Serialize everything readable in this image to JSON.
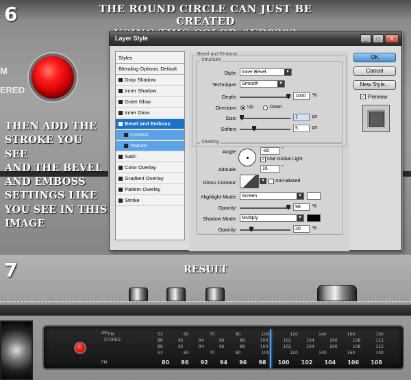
{
  "step6": {
    "number": "6",
    "title_line1": "THE ROUND CIRCLE CAN JUST BE CREATED",
    "title_line2": "USING THIS COLOR #EB0202",
    "instructions": [
      "THEN ADD THE",
      "STROKE YOU SEE",
      "AND THE BEVEL",
      "AND EMBOSS",
      "SETTINGS LIKE",
      "YOU SEE IN THIS",
      "IMAGE"
    ],
    "stereo_label_top": "M",
    "stereo_label_bottom": "ERED",
    "circle_color": "#EB0202"
  },
  "dialog": {
    "title": "Layer Style",
    "window_controls": {
      "minimize": "_",
      "maximize": "□",
      "close": "X"
    },
    "styles_list": [
      {
        "label": "Styles",
        "kind": "header"
      },
      {
        "label": "Blending Options: Default",
        "kind": "header"
      },
      {
        "label": "Drop Shadow",
        "kind": "item"
      },
      {
        "label": "Inner Shadow",
        "kind": "item"
      },
      {
        "label": "Outer Glow",
        "kind": "item"
      },
      {
        "label": "Inner Glow",
        "kind": "item"
      },
      {
        "label": "Bevel and Emboss",
        "kind": "selected"
      },
      {
        "label": "Contour",
        "kind": "sub"
      },
      {
        "label": "Texture",
        "kind": "sub"
      },
      {
        "label": "Satin",
        "kind": "item"
      },
      {
        "label": "Color Overlay",
        "kind": "item"
      },
      {
        "label": "Gradient Overlay",
        "kind": "item"
      },
      {
        "label": "Pattern Overlay",
        "kind": "item"
      },
      {
        "label": "Stroke",
        "kind": "item"
      }
    ],
    "structure": {
      "group_title": "Bevel and Emboss",
      "section": "Structure",
      "style_label": "Style:",
      "style_value": "Inner Bevel",
      "technique_label": "Technique:",
      "technique_value": "Smooth",
      "depth_label": "Depth:",
      "depth_value": "1000",
      "depth_unit": "%",
      "direction_label": "Direction:",
      "direction_up": "Up",
      "direction_down": "Down",
      "size_label": "Size:",
      "size_value": "1",
      "size_unit": "px",
      "soften_label": "Soften:",
      "soften_value": "5",
      "soften_unit": "px"
    },
    "shading": {
      "section": "Shading",
      "angle_label": "Angle:",
      "angle_value": "-90",
      "angle_unit": "°",
      "use_global_light": "Use Global Light",
      "altitude_label": "Altitude:",
      "altitude_value": "16",
      "altitude_unit": "°",
      "gloss_label": "Gloss Contour:",
      "anti_aliased": "Anti-aliased",
      "highlight_mode_label": "Highlight Mode:",
      "highlight_mode_value": "Screen",
      "highlight_color": "#ffffff",
      "highlight_opacity_label": "Opacity:",
      "highlight_opacity_value": "98",
      "highlight_opacity_unit": "%",
      "shadow_mode_label": "Shadow Mode:",
      "shadow_mode_value": "Multiply",
      "shadow_color": "#000000",
      "shadow_opacity_label": "Opacity:",
      "shadow_opacity_value": "20",
      "shadow_opacity_unit": "%"
    },
    "buttons": {
      "ok": "OK",
      "cancel": "Cancel",
      "new_style": "New Style...",
      "preview": "Preview"
    }
  },
  "step7": {
    "number": "7",
    "result_label": "RESULT",
    "tuner": {
      "am_tag": "AM",
      "fm_tag": "FM",
      "fm_stereo_tag": "FM",
      "stereo_tag": "STEREO",
      "row1": [
        "53",
        "60",
        "70",
        "80",
        "100",
        "120",
        "140",
        "160",
        "100"
      ],
      "row2": [
        "88",
        "92",
        "94",
        "96",
        "98",
        "100",
        "102",
        "104",
        "106",
        "108",
        "112"
      ],
      "big_scale": [
        "80",
        "86",
        "92",
        "94",
        "96",
        "98",
        "100",
        "102",
        "104",
        "106",
        "108"
      ]
    }
  }
}
